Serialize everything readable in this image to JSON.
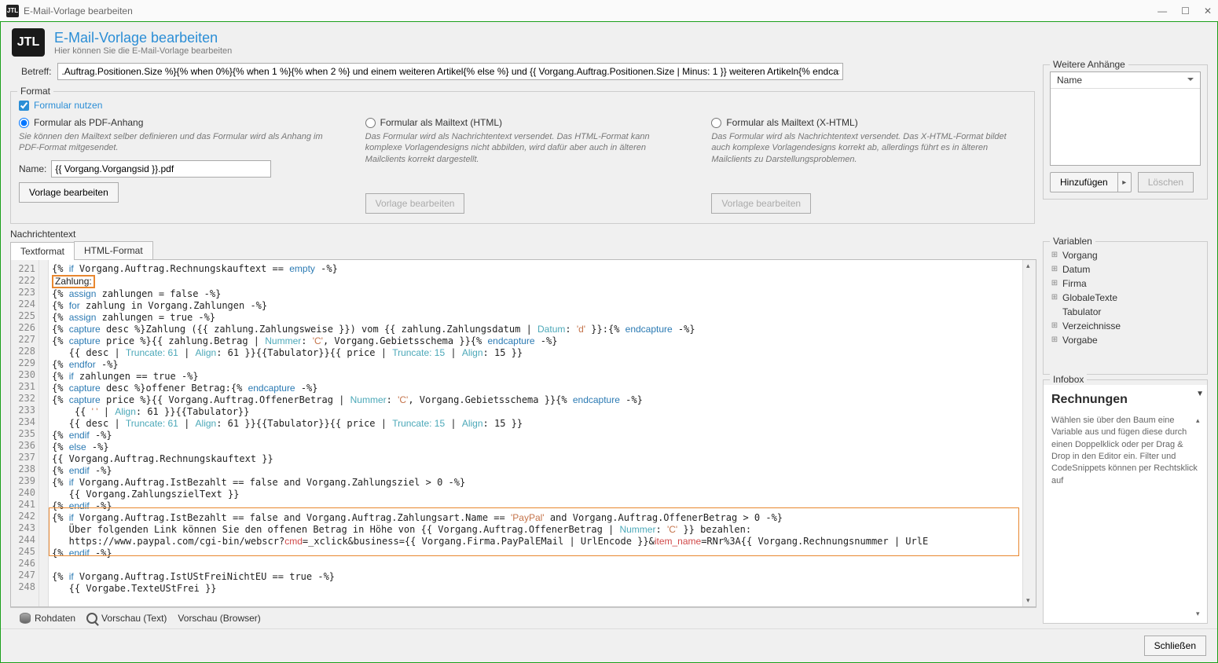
{
  "window": {
    "title": "E-Mail-Vorlage bearbeiten"
  },
  "win_controls": {
    "min": "—",
    "max": "☐",
    "close": "✕"
  },
  "header": {
    "logo": "JTL",
    "title": "E-Mail-Vorlage bearbeiten",
    "subtitle": "Hier können Sie die E-Mail-Vorlage bearbeiten"
  },
  "subject": {
    "label": "Betreff:",
    "value": ".Auftrag.Positionen.Size %}{% when 0%}{% when 1 %}{% when 2 %} und einem weiteren Artikel{% else %} und {{ Vorgang.Auftrag.Positionen.Size | Minus: 1 }} weiteren Artikeln{% endcase%} von {{ Vorgang.Firma.Name }}"
  },
  "format": {
    "title": "Format",
    "use_form": "Formular nutzen",
    "opt1": {
      "label": "Formular als PDF-Anhang",
      "desc": "Sie können den Mailtext selber definieren und das Formular wird als Anhang im PDF-Format mitgesendet.",
      "name_label": "Name:",
      "name_value": "{{ Vorgang.Vorgangsid }}.pdf",
      "btn": "Vorlage bearbeiten"
    },
    "opt2": {
      "label": "Formular als Mailtext (HTML)",
      "desc": "Das Formular wird als Nachrichtentext versendet. Das HTML-Format kann komplexe Vorlagendesigns nicht abbilden, wird dafür aber auch in älteren Mailclients korrekt dargestellt.",
      "btn": "Vorlage bearbeiten"
    },
    "opt3": {
      "label": "Formular als Mailtext (X-HTML)",
      "desc": "Das Formular wird als Nachrichtentext versendet. Das X-HTML-Format bildet auch komplexe Vorlagendesigns korrekt ab, allerdings führt es in älteren Mailclients zu Darstellungsproblemen.",
      "btn": "Vorlage bearbeiten"
    }
  },
  "attachments": {
    "title": "Weitere Anhänge",
    "header": "Name",
    "add": "Hinzufügen",
    "del": "Löschen"
  },
  "msg": {
    "label": "Nachrichtentext",
    "tabs": [
      "Textformat",
      "HTML-Format"
    ]
  },
  "lines": [
    "221",
    "222",
    "223",
    "224",
    "225",
    "226",
    "227",
    "228",
    "229",
    "230",
    "231",
    "232",
    "233",
    "234",
    "235",
    "236",
    "237",
    "238",
    "239",
    "240",
    "241",
    "242",
    "243",
    "244",
    "245",
    "246",
    "247",
    "248"
  ],
  "code_hl": "Zahlung:",
  "vars": {
    "title": "Variablen",
    "items": [
      "Vorgang",
      "Datum",
      "Firma",
      "GlobaleTexte",
      "Tabulator",
      "Verzeichnisse",
      "Vorgabe"
    ]
  },
  "infobox": {
    "title": "Infobox",
    "heading": "Rechnungen",
    "text": "Wählen sie über den Baum eine Variable aus und fügen diese durch einen Doppelklick oder per Drag & Drop in den Editor ein. Filter und CodeSnippets können per Rechtsklick auf"
  },
  "bottom": {
    "raw": "Rohdaten",
    "prev_text": "Vorschau (Text)",
    "prev_browser": "Vorschau (Browser)"
  },
  "footer": {
    "close": "Schließen"
  }
}
